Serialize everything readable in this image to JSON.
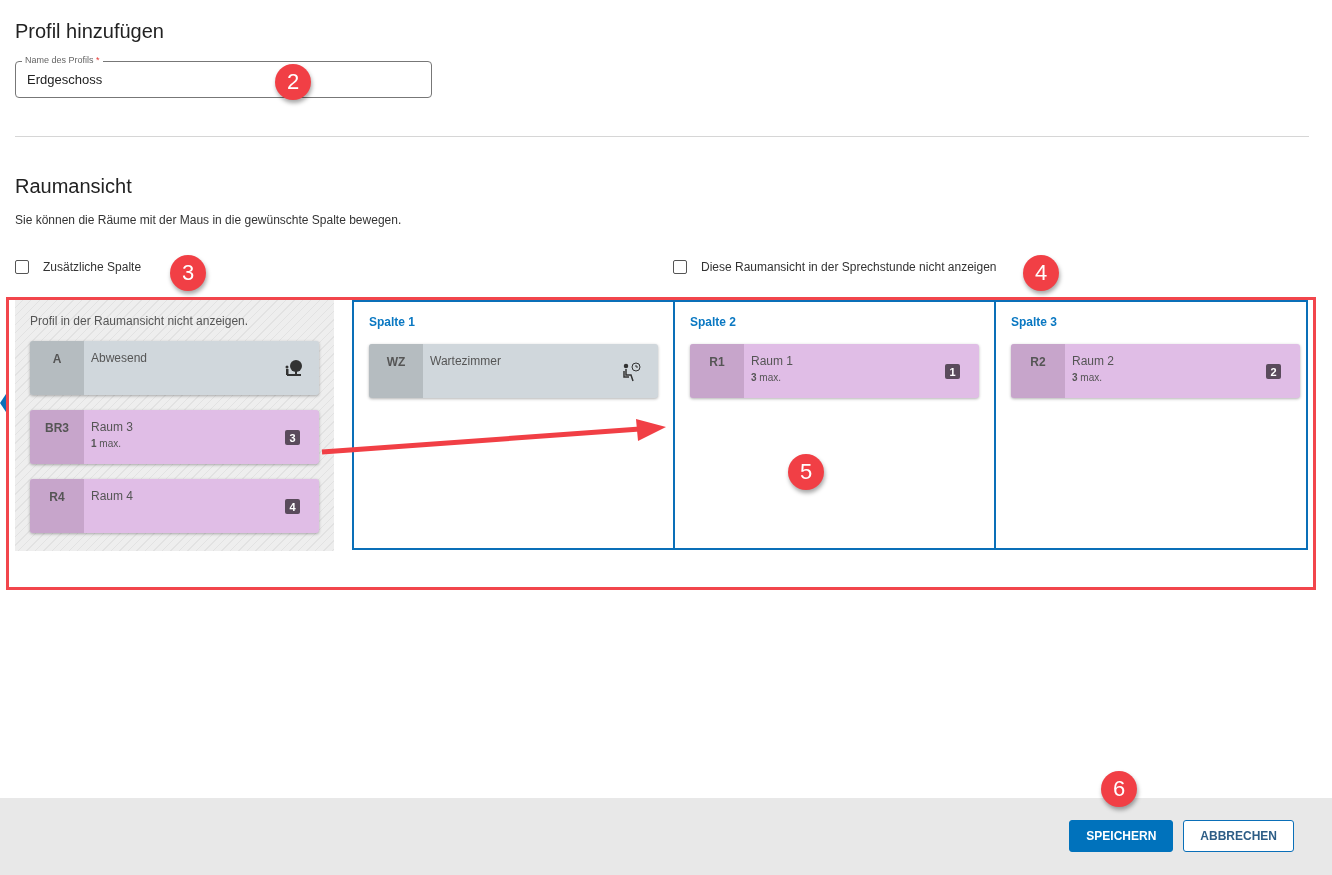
{
  "page_title": "Profil hinzufügen",
  "profile_name": {
    "label": "Name des Profils",
    "required_mark": "*",
    "value": "Erdgeschoss"
  },
  "section_title": "Raumansicht",
  "description": "Sie können die Räume mit der Maus in die gewünschte Spalte bewegen.",
  "options": [
    {
      "label": "Zusätzliche Spalte",
      "checked": false
    },
    {
      "label": "Diese Raumansicht in der Sprechstunde nicht anzeigen",
      "checked": false
    }
  ],
  "hidden_area": {
    "title": "Profil in der Raumansicht nicht anzeigen.",
    "rooms": [
      {
        "kind": "absent",
        "code": "A",
        "name": "Abwesend"
      },
      {
        "kind": "room",
        "code": "BR3",
        "name": "Raum 3",
        "capacity": "**1** max.",
        "number": "3"
      },
      {
        "kind": "room",
        "code": "R4",
        "name": "Raum 4",
        "number": "4"
      }
    ]
  },
  "columns": [
    {
      "title": "Spalte 1",
      "rooms": [
        {
          "kind": "waiting",
          "code": "WZ",
          "name": "Wartezimmer"
        }
      ]
    },
    {
      "title": "Spalte 2",
      "rooms": [
        {
          "kind": "room",
          "code": "R1",
          "name": "Raum 1",
          "capacity": "**3** max.",
          "number": "1"
        }
      ]
    },
    {
      "title": "Spalte 3",
      "rooms": [
        {
          "kind": "room",
          "code": "R2",
          "name": "Raum 2",
          "capacity": "**3** max.",
          "number": "2"
        }
      ]
    }
  ],
  "buttons": [
    {
      "kind": "primary",
      "label": "SPEICHERN"
    },
    {
      "kind": "secondary",
      "label": "ABBRECHEN"
    }
  ],
  "annotations": [
    "2",
    "3",
    "4",
    "5",
    "6"
  ]
}
